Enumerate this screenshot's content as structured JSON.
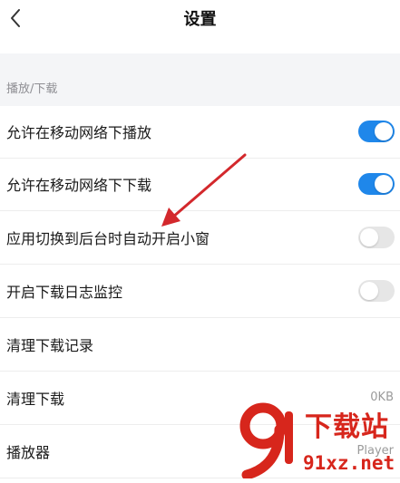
{
  "header": {
    "title": "设置"
  },
  "section": {
    "label": "播放/下载"
  },
  "settings": [
    {
      "label": "允许在移动网络下播放",
      "toggle": "on"
    },
    {
      "label": "允许在移动网络下下载",
      "toggle": "on"
    },
    {
      "label": "应用切换到后台时自动开启小窗",
      "toggle": "off"
    },
    {
      "label": "开启下载日志监控",
      "toggle": "off"
    },
    {
      "label": "清理下载记录"
    },
    {
      "label": "清理下载",
      "value": "0KB"
    },
    {
      "label": "播放器",
      "value": "Player"
    }
  ],
  "watermark": {
    "title": "下载站",
    "url": "91xz.net"
  },
  "colors": {
    "toggle_on": "#1f87ea",
    "toggle_off": "#e6e6e6",
    "arrow": "#d3282c",
    "watermark": "#d7261c"
  }
}
